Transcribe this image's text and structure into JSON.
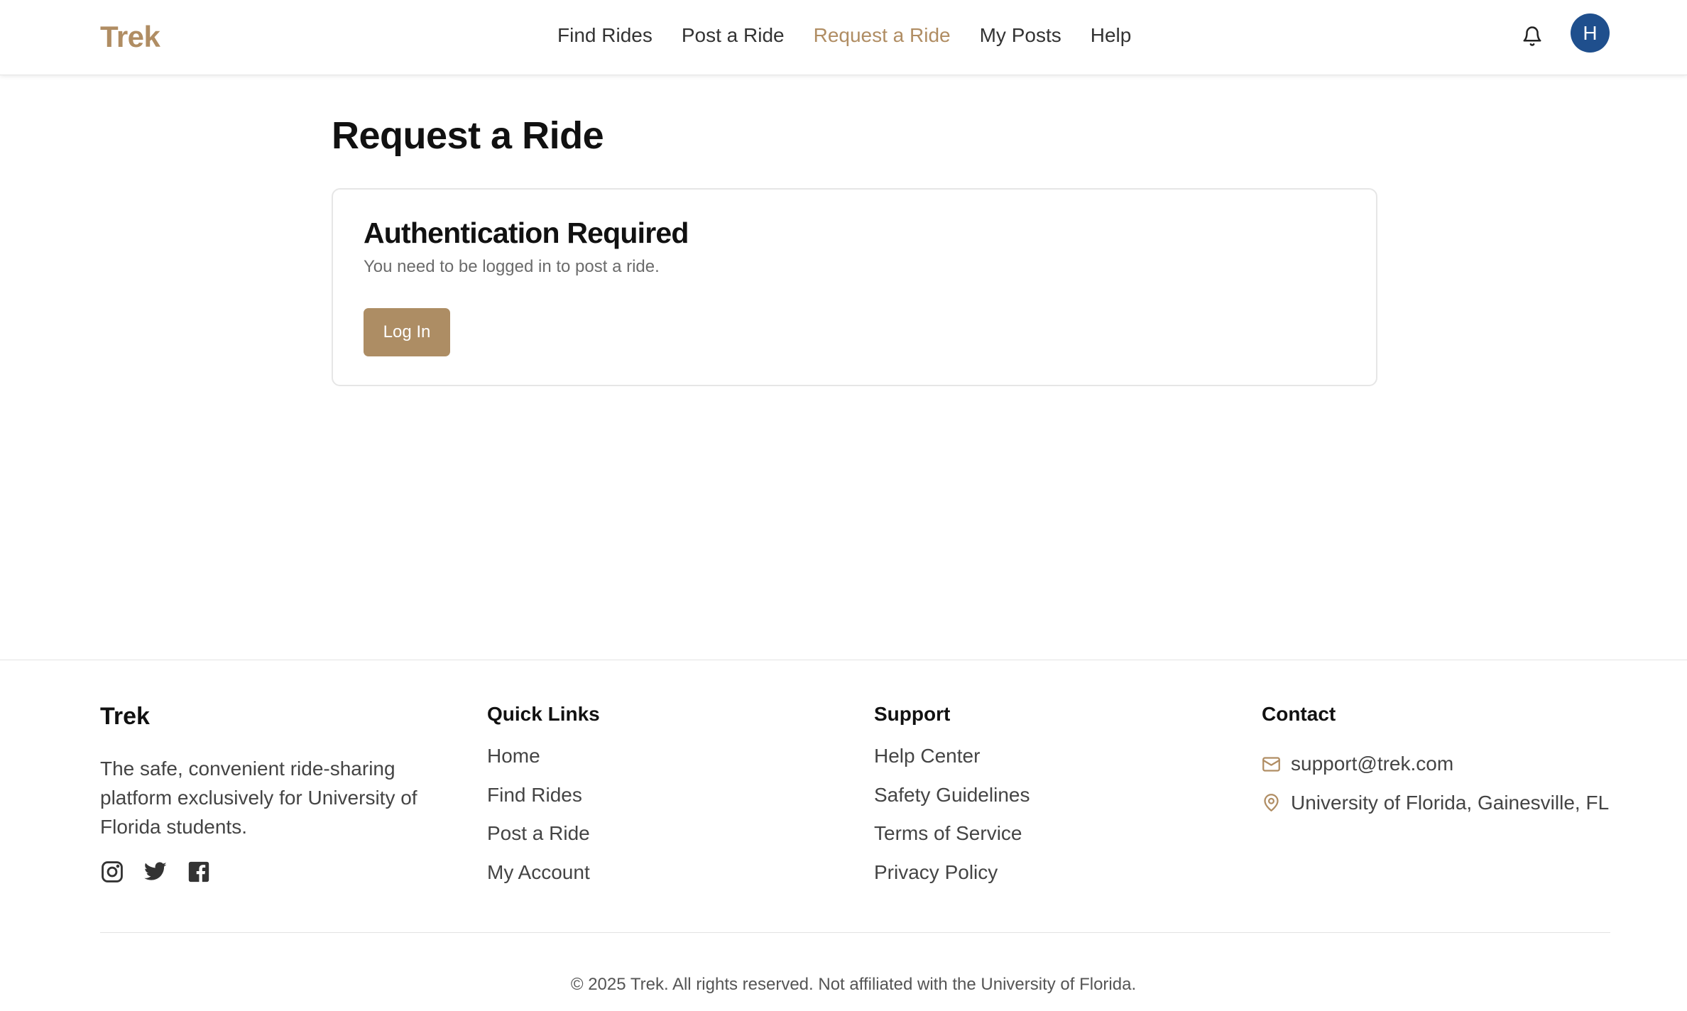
{
  "header": {
    "logo": "Trek",
    "nav": [
      {
        "label": "Find Rides",
        "active": false
      },
      {
        "label": "Post a Ride",
        "active": false
      },
      {
        "label": "Request a Ride",
        "active": true
      },
      {
        "label": "My Posts",
        "active": false
      },
      {
        "label": "Help",
        "active": false
      }
    ],
    "bell_icon": "bell-icon",
    "avatar_initial": "H"
  },
  "main": {
    "title": "Request a Ride",
    "card": {
      "title": "Authentication Required",
      "description": "You need to be logged in to post a ride.",
      "button_label": "Log In"
    }
  },
  "footer": {
    "brand": "Trek",
    "tagline": "The safe, convenient ride-sharing platform exclusively for University of Florida students.",
    "social_icons": [
      "instagram-icon",
      "twitter-icon",
      "facebook-icon"
    ],
    "quick_links": {
      "heading": "Quick Links",
      "items": [
        "Home",
        "Find Rides",
        "Post a Ride",
        "My Account"
      ]
    },
    "support": {
      "heading": "Support",
      "items": [
        "Help Center",
        "Safety Guidelines",
        "Terms of Service",
        "Privacy Policy"
      ]
    },
    "contact": {
      "heading": "Contact",
      "email": "support@trek.com",
      "address": "University of Florida, Gainesville, FL"
    },
    "copyright": "© 2025 Trek. All rights reserved. Not affiliated with the University of Florida."
  },
  "colors": {
    "brand": "#b08d63",
    "button": "#ad8d64",
    "avatar": "#1f4f8d"
  }
}
